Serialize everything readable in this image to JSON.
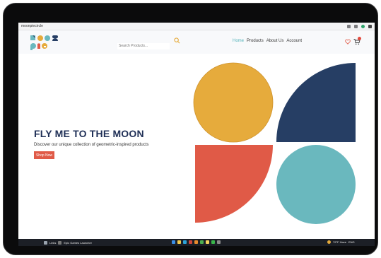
{
  "browser": {
    "url": "moonpiecircle"
  },
  "header": {
    "search_placeholder": "Search Products...",
    "nav": [
      {
        "label": "Home",
        "active": true
      },
      {
        "label": "Products",
        "active": false
      },
      {
        "label": "About Us",
        "active": false
      },
      {
        "label": "Account",
        "active": false
      }
    ]
  },
  "hero": {
    "title": "FLY ME TO THE MOON",
    "subtitle": "Discover our unique collection of geometric-inspired products",
    "button_label": "Shop Now"
  },
  "colors": {
    "navy": "#263e64",
    "mustard": "#e6ab3c",
    "coral": "#e05a47",
    "teal": "#6ab8be",
    "accent_nav": "#4fb0b8"
  },
  "taskbar": {
    "news_label": "Links",
    "launcher_label": "Epic Games Launcher",
    "weather": "79°F Haze",
    "status": "ENG"
  },
  "icons": [
    "search-icon",
    "heart-icon",
    "cart-icon",
    "menu-icon",
    "windows-icon"
  ]
}
